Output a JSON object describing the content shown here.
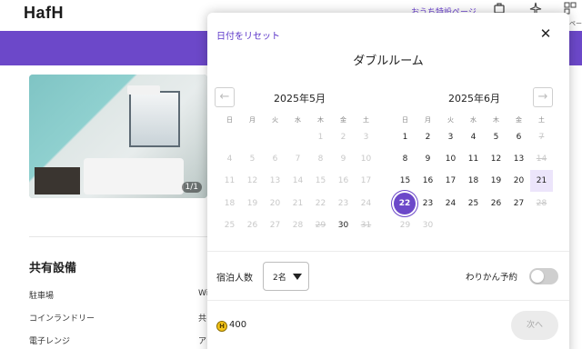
{
  "header": {
    "logo": "HafH",
    "nav_link": "おうち特設ページ",
    "nav_sub": "マイページ",
    "icons": [
      "suitcase-icon",
      "plane-icon",
      "grid-icon"
    ]
  },
  "room_photo": {
    "counter": "1/1"
  },
  "amenities": {
    "title": "共有設備",
    "left": [
      "駐車場",
      "コインランドリー",
      "電子レンジ"
    ],
    "right": [
      "Wi",
      "共",
      "ア"
    ]
  },
  "modal": {
    "reset_label": "日付をリセット",
    "title": "ダブルルーム",
    "close_icon": "close-icon",
    "prev_icon": "arrow-left-icon",
    "next_icon": "arrow-right-icon",
    "weekdays": [
      "日",
      "月",
      "火",
      "水",
      "木",
      "金",
      "土"
    ],
    "months": [
      {
        "label": "2025年5月",
        "weeks": [
          [
            "",
            "",
            "",
            "",
            "1",
            "2",
            "3"
          ],
          [
            "4",
            "5",
            "6",
            "7",
            "8",
            "9",
            "10"
          ],
          [
            "11",
            "12",
            "13",
            "14",
            "15",
            "16",
            "17"
          ],
          [
            "18",
            "19",
            "20",
            "21",
            "22",
            "23",
            "24"
          ],
          [
            "25",
            "26",
            "27",
            "28",
            "29",
            "30",
            "31"
          ]
        ],
        "available": [
          "30"
        ],
        "struck": [
          "29",
          "31"
        ]
      },
      {
        "label": "2025年6月",
        "weeks": [
          [
            "1",
            "2",
            "3",
            "4",
            "5",
            "6",
            "7"
          ],
          [
            "8",
            "9",
            "10",
            "11",
            "12",
            "13",
            "14"
          ],
          [
            "15",
            "16",
            "17",
            "18",
            "19",
            "20",
            "21"
          ],
          [
            "22",
            "23",
            "24",
            "25",
            "26",
            "27",
            "28"
          ],
          [
            "29",
            "30",
            "",
            "",
            "",
            "",
            ""
          ]
        ],
        "available": [
          "1",
          "2",
          "3",
          "4",
          "5",
          "6",
          "8",
          "9",
          "10",
          "11",
          "12",
          "13",
          "15",
          "16",
          "17",
          "18",
          "19",
          "20",
          "21",
          "22",
          "23",
          "24",
          "25",
          "26",
          "27"
        ],
        "struck": [
          "7",
          "14",
          "28"
        ]
      }
    ],
    "selected_date": "22",
    "range_end_date": "21",
    "guests_label": "宿泊人数",
    "guests_value": "2名",
    "wari_label": "わりかん予約",
    "wari_enabled": false,
    "coin_symbol": "H",
    "points": "400",
    "next_label": "次へ",
    "accent_color": "#6c48c9"
  }
}
